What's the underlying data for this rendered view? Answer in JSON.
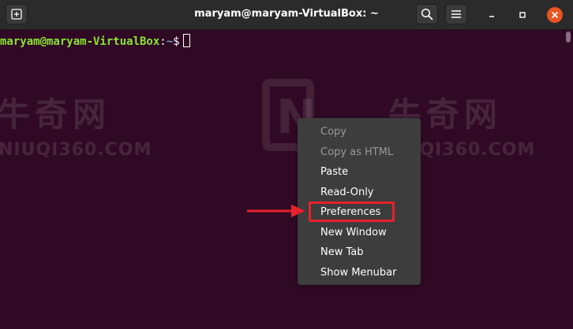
{
  "window": {
    "title": "maryam@maryam-VirtualBox: ~",
    "colors": {
      "headerbar": "#2b2b2b",
      "terminal_bg": "#300a24",
      "close": "#e95420"
    },
    "icons": [
      "new-tab-icon",
      "search-icon",
      "hamburger-menu-icon",
      "minimize-icon",
      "maximize-icon",
      "close-icon"
    ]
  },
  "terminal": {
    "prompt": {
      "user_host": "maryam@maryam-VirtualBox",
      "sep": ":",
      "path": "~",
      "dollar": "$"
    },
    "colors": {
      "user": "#8ae234",
      "path": "#729fcf"
    }
  },
  "watermark": {
    "cn_left": "牛奇网",
    "en_left": "NIUQI360.COM",
    "cn_right": "牛奇网",
    "en_right": "NIUQI360.COM",
    "logo_letter": "N"
  },
  "context_menu": {
    "items": [
      {
        "label": "Copy",
        "enabled": false
      },
      {
        "label": "Copy as HTML",
        "enabled": false
      },
      {
        "label": "Paste",
        "enabled": true
      },
      {
        "label": "Read-Only",
        "enabled": true
      },
      {
        "label": "Preferences",
        "enabled": true,
        "highlighted": true
      },
      {
        "label": "New Window",
        "enabled": true
      },
      {
        "label": "New Tab",
        "enabled": true
      },
      {
        "label": "Show Menubar",
        "enabled": true
      }
    ],
    "annotation_color": "#e6212a"
  }
}
